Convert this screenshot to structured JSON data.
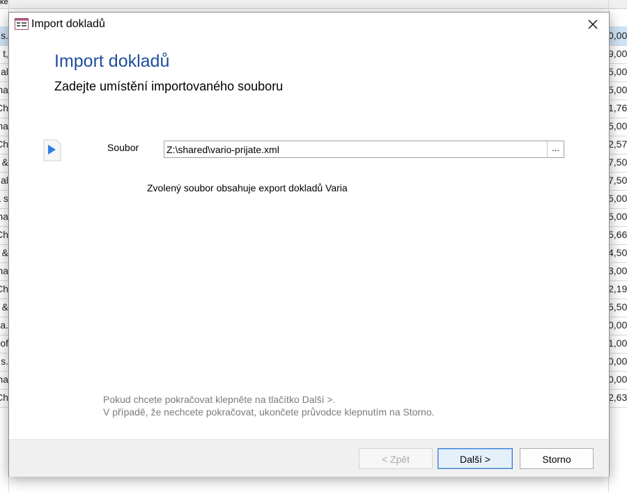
{
  "background_sheet": {
    "left_fragments": [
      "ke",
      "s.",
      "t,",
      "al",
      "na",
      "Ch",
      "na",
      "Ch",
      "&",
      "al",
      "a s",
      "na",
      "Ch",
      "&",
      "na",
      "Ch",
      "&",
      "a.",
      "of",
      "s.",
      "na",
      "Ch"
    ],
    "right_fragments": [
      "",
      "0,00",
      "9,00",
      "5,00",
      "5,00",
      "1,76",
      "5,00",
      "2,57",
      "7,50",
      "7,50",
      "5,00",
      "5,00",
      "5,66",
      "4,50",
      "3,00",
      "2,19",
      "5,50",
      "0,00",
      "1,00",
      "0,00",
      "0,00",
      "2,63"
    ]
  },
  "dialog": {
    "title": "Import dokladů",
    "heading": "Import dokladů",
    "subheading": "Zadejte umístění importovaného souboru",
    "file_label": "Soubor",
    "file_value": "Z:\\shared\\vario-prijate.xml",
    "browse_label": "...",
    "info": "Zvolený soubor obsahuje export dokladů Varia",
    "hint_line1": "Pokud chcete pokračovat klepněte na tlačítko Další >.",
    "hint_line2": "V případě, že nechcete pokračovat, ukončete průvodce klepnutím na Storno.",
    "buttons": {
      "back": "< Zpět",
      "next": "Další >",
      "cancel": "Storno"
    }
  },
  "colors": {
    "heading": "#1f4e9c",
    "hint": "#7a7a7a",
    "selected_row": "#cfe3f6",
    "primary_border": "#3c7fd6"
  },
  "icons": {
    "title": "form-icon",
    "close": "close-icon",
    "arrow": "play-arrow-icon"
  }
}
